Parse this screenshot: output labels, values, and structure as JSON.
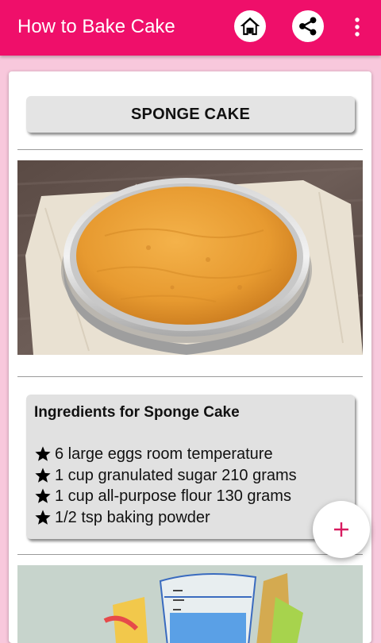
{
  "app_bar": {
    "title": "How to Bake Cake",
    "background": "#ef0f6a",
    "icons": [
      "home-icon",
      "share-icon",
      "more-vert-icon"
    ]
  },
  "recipe": {
    "title": "SPONGE CAKE",
    "image_alt": "sponge-cake-photo",
    "ingredients_heading": "Ingredients for Sponge Cake",
    "ingredients": [
      "6 large eggs room temperature",
      "1 cup granulated sugar 210 grams",
      "1 cup all-purpose flour 130 grams",
      "1/2 tsp baking powder"
    ],
    "bullet_icon": "star-icon"
  },
  "fab": {
    "icon": "plus-icon",
    "accent": "#d81b60"
  }
}
